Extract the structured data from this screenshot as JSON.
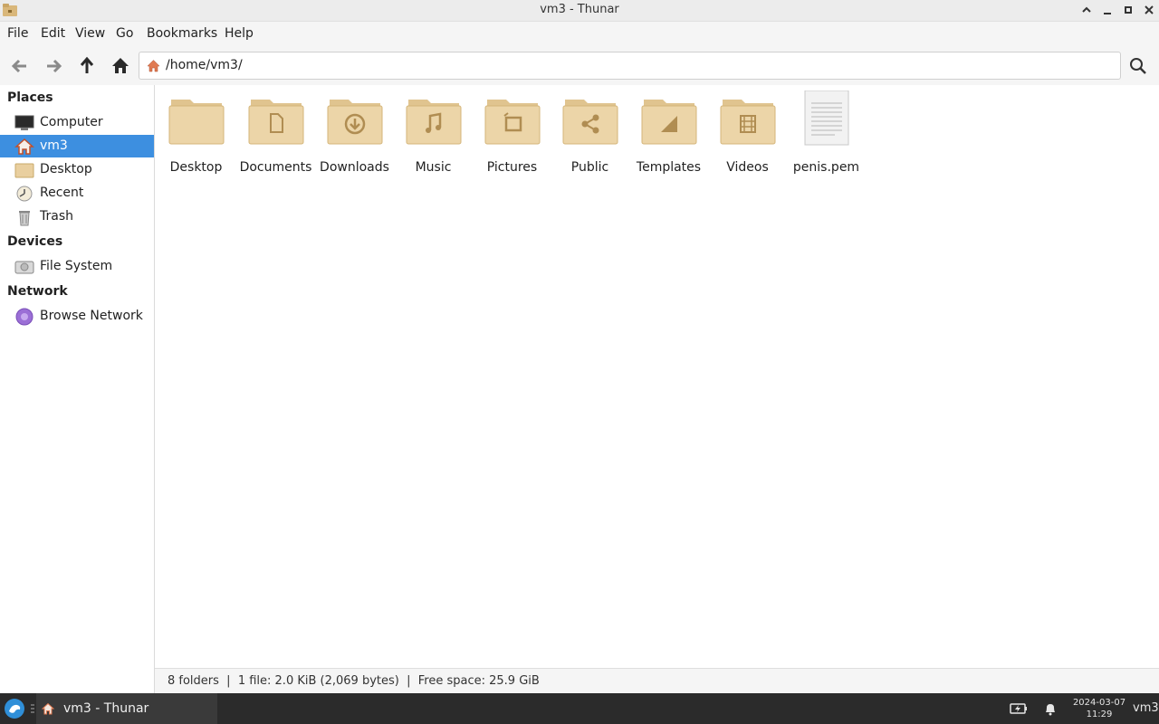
{
  "window": {
    "title": "vm3 - Thunar"
  },
  "menubar": {
    "items": [
      {
        "label": "File"
      },
      {
        "label": "Edit"
      },
      {
        "label": "View"
      },
      {
        "label": "Go"
      },
      {
        "label": "Bookmarks"
      },
      {
        "label": "Help"
      }
    ]
  },
  "toolbar": {
    "location_path": "/home/vm3/"
  },
  "sidebar": {
    "places_header": "Places",
    "places": [
      {
        "label": "Computer",
        "icon": "computer-icon"
      },
      {
        "label": "vm3",
        "icon": "home-icon",
        "selected": true
      },
      {
        "label": "Desktop",
        "icon": "folder-icon"
      },
      {
        "label": "Recent",
        "icon": "clock-icon"
      },
      {
        "label": "Trash",
        "icon": "trash-icon"
      }
    ],
    "devices_header": "Devices",
    "devices": [
      {
        "label": "File System",
        "icon": "drive-icon"
      }
    ],
    "network_header": "Network",
    "network": [
      {
        "label": "Browse Network",
        "icon": "network-icon"
      }
    ]
  },
  "files": [
    {
      "name": "Desktop",
      "type": "folder",
      "emblem": "none"
    },
    {
      "name": "Documents",
      "type": "folder",
      "emblem": "document"
    },
    {
      "name": "Downloads",
      "type": "folder",
      "emblem": "download"
    },
    {
      "name": "Music",
      "type": "folder",
      "emblem": "music"
    },
    {
      "name": "Pictures",
      "type": "folder",
      "emblem": "picture"
    },
    {
      "name": "Public",
      "type": "folder",
      "emblem": "share"
    },
    {
      "name": "Templates",
      "type": "folder",
      "emblem": "template"
    },
    {
      "name": "Videos",
      "type": "folder",
      "emblem": "video"
    },
    {
      "name": "penis.pem",
      "type": "text-file",
      "emblem": "none"
    }
  ],
  "statusbar": {
    "text": "8 folders  |  1 file: 2.0 KiB (2,069 bytes)  |  Free space: 25.9 GiB"
  },
  "taskbar": {
    "task_label": "vm3 - Thunar",
    "date": "2024-03-07",
    "time": "11:29",
    "user": "vm3"
  },
  "colors": {
    "selection": "#3d8fe0",
    "folder": "#e9cf9f",
    "taskbar": "#2b2b2b"
  }
}
